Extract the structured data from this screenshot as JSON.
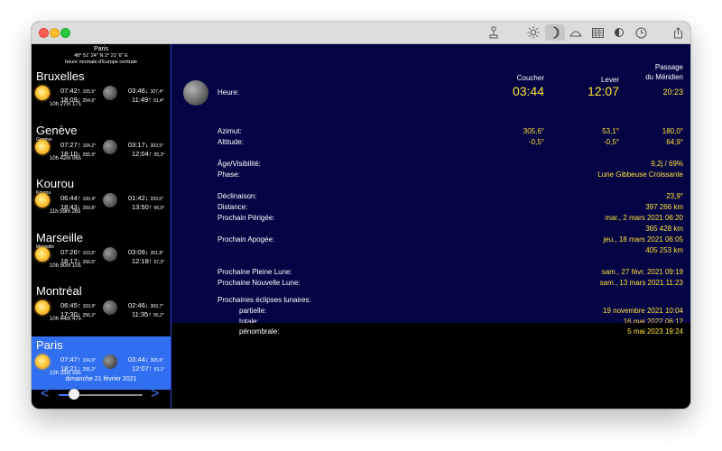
{
  "toolbar": {
    "icons": [
      "compass-icon",
      "sun-icon",
      "moon-icon",
      "horizon-icon",
      "table-icon",
      "phase-icon",
      "clock-icon",
      "share-icon"
    ],
    "active": "moon-icon"
  },
  "sidebar": {
    "header": {
      "city": "Paris",
      "coords": "48° 51' 24'' N  2° 21' 6'' E",
      "timezone": "heure normale d'Europe centrale"
    },
    "cities": [
      {
        "name": "Bruxelles",
        "sub": "",
        "sunrise": "07:42",
        "sunrise_az": "105,5°",
        "sunset": "18:09",
        "sunset_az": "254,6°",
        "moonset": "03:46",
        "moonset_az": "307,4°",
        "moonrise": "11:49",
        "moonrise_az": "51,4°",
        "daylength": "10h 27m 17s",
        "selected": false
      },
      {
        "name": "Genève",
        "sub": "Genève",
        "sunrise": "07:27",
        "sunrise_az": "104,2°",
        "sunset": "18:10",
        "sunset_az": "255,9°",
        "moonset": "03:17",
        "moonset_az": "303,5°",
        "moonrise": "12:04",
        "moonrise_az": "55,3°",
        "daylength": "10h 42m 06s",
        "selected": false
      },
      {
        "name": "Kourou",
        "sub": "Kourou",
        "sunrise": "06:44",
        "sunrise_az": "100,4°",
        "sunset": "18:43",
        "sunset_az": "259,8°",
        "moonset": "01:42",
        "moonset_az": "293,0°",
        "moonrise": "13:50",
        "moonrise_az": "66,0°",
        "daylength": "11h 59m 26s",
        "selected": false
      },
      {
        "name": "Marseille",
        "sub": "Marseille",
        "sunrise": "07:26",
        "sunrise_az": "103,6°",
        "sunset": "18:17",
        "sunset_az": "256,6°",
        "moonset": "03:09",
        "moonset_az": "301,8°",
        "moonrise": "12:18",
        "moonrise_az": "57,2°",
        "daylength": "10h 50m 10s",
        "selected": false
      },
      {
        "name": "Montréal",
        "sub": "",
        "sunrise": "06:45",
        "sunrise_az": "103,9°",
        "sunset": "17:30",
        "sunset_az": "256,2°",
        "moonset": "02:46",
        "moonset_az": "303,7°",
        "moonrise": "11:35",
        "moonrise_az": "55,2°",
        "daylength": "10h 44m 47s",
        "selected": false
      },
      {
        "name": "Paris",
        "sub": "",
        "sunrise": "07:47",
        "sunrise_az": "104,9°",
        "sunset": "18:21",
        "sunset_az": "255,2°",
        "moonset": "03:44",
        "moonset_az": "305,6°",
        "moonrise": "12:07",
        "moonrise_az": "53,1°",
        "daylength": "10h 33m 59s",
        "selected": true
      }
    ],
    "date": "dimanche 21 février 2021",
    "prev_arrow": "<",
    "next_arrow": ">",
    "slider_fraction": 0.18
  },
  "main": {
    "columns": {
      "set": "Coucher",
      "rise": "Lever",
      "transit_l1": "Passage",
      "transit_l2": "du Méridien"
    },
    "heure": {
      "label": "Heure:",
      "set": "03:44",
      "rise": "12:07",
      "transit": "20:23"
    },
    "azimut": {
      "label": "Azimut:",
      "set": "305,6°",
      "rise": "53,1°",
      "transit": "180,0°"
    },
    "altitude": {
      "label": "Altitude:",
      "set": "-0,5°",
      "rise": "-0,5°",
      "transit": "64,9°"
    },
    "age": {
      "label": "Âge/Visibilité:",
      "value": "9,2j / 69%"
    },
    "phase": {
      "label": "Phase:",
      "value": "Lune Gibbeuse Croissante"
    },
    "declinaison": {
      "label": "Déclinaison:",
      "value": "23,9°"
    },
    "distance": {
      "label": "Distance:",
      "value": "397 266 km"
    },
    "perigee": {
      "label": "Prochain Périgée:",
      "date": "mar., 2 mars 2021 06:20",
      "dist": "365 428 km"
    },
    "apogee": {
      "label": "Prochain Apogée:",
      "date": "jeu., 18 mars 2021 06:05",
      "dist": "405 253 km"
    },
    "full_moon": {
      "label": "Prochaine Pleine Lune:",
      "value": "sam., 27 févr. 2021 09:19"
    },
    "new_moon": {
      "label": "Prochaine Nouvelle Lune:",
      "value": "sam., 13 mars 2021 11:23"
    },
    "eclipses": {
      "label": "Prochaines éclipses lunaires:",
      "partial_label": "partielle:",
      "partial": "19 novembre 2021 10:04",
      "total_label": "totale:",
      "total": "16 mai 2022 06:12",
      "penumbral_label": "pénombrale:",
      "penumbral": "5 mai 2023 19:24"
    }
  }
}
